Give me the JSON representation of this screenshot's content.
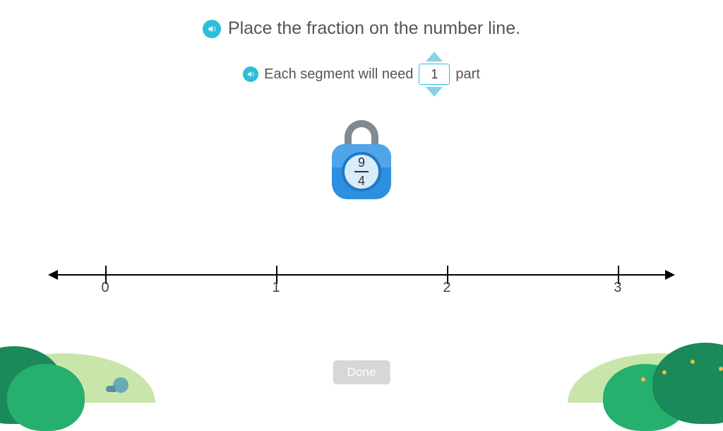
{
  "title": "Place the fraction on the number line.",
  "subline": {
    "prefix": "Each segment will need",
    "value": "1",
    "suffix": "part"
  },
  "fraction": {
    "numerator": "9",
    "denominator": "4"
  },
  "numberline": {
    "labels": [
      "0",
      "1",
      "2",
      "3"
    ]
  },
  "buttons": {
    "done": "Done"
  },
  "icons": {
    "speaker": "speaker-icon",
    "chevron_up": "chevron-up-icon",
    "chevron_down": "chevron-down-icon"
  }
}
